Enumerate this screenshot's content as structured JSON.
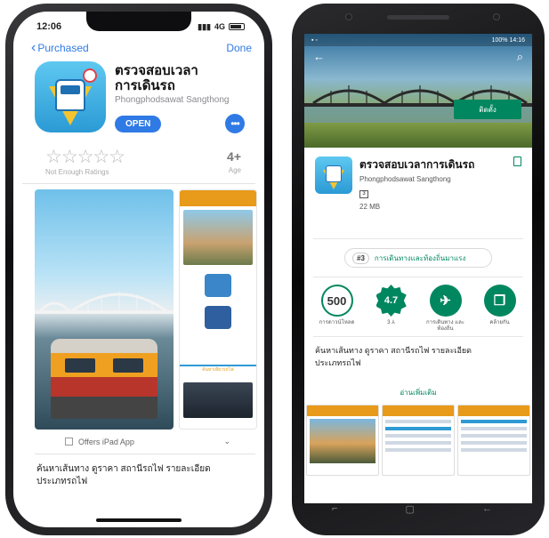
{
  "ios": {
    "status": {
      "time": "12:06",
      "network": "4G"
    },
    "nav": {
      "back_label": "Purchased",
      "done_label": "Done"
    },
    "app": {
      "name_line1": "ตรวจสอบเวลา",
      "name_line2": "การเดินรถ",
      "developer": "Phongphodsawat Sangthong",
      "open_label": "OPEN",
      "more_label": "•••"
    },
    "rating": {
      "stars": "☆☆☆☆☆",
      "note": "Not Enough Ratings",
      "age": "4+",
      "age_label": "Age"
    },
    "ipad_label": "Offers iPad App",
    "description": [
      "ค้นหาเส้นทาง ดูราคา สถานีรถไฟ รายละเอียด",
      "ประเภทรถไฟ"
    ],
    "screenshot_caption": "ค้นหาเที่ยวรถไฟ"
  },
  "android": {
    "status": {
      "battery": "100%",
      "time": "14:16"
    },
    "app": {
      "name": "ตรวจสอบเวลาการเดินรถ",
      "developer": "Phongphodsawat Sangthong",
      "rated": "3",
      "size": "22 MB",
      "install_label": "ติดตั้ง"
    },
    "rank": {
      "number": "#3",
      "category": "การเดินทางและท้องถิ่นมาแรง"
    },
    "stats": [
      {
        "value": "500",
        "label": "การดาวน์โหลด"
      },
      {
        "value": "4.7",
        "label": "3 ⅄"
      },
      {
        "icon": "airplane-icon",
        "label": "การเดินทาง และท้องถิ่น"
      },
      {
        "icon": "similar-apps-icon",
        "label": "คล้ายกัน"
      }
    ],
    "description": [
      "ค้นหาเส้นทาง ดูราคา สถานีรถไฟ รายละเอียด",
      "ประเภทรถไฟ"
    ],
    "read_more": "อ่านเพิ่มเติม"
  },
  "colors": {
    "ios_blue": "#2f7ae5",
    "play_green": "#01875f",
    "brand_orange": "#e89a1a"
  }
}
